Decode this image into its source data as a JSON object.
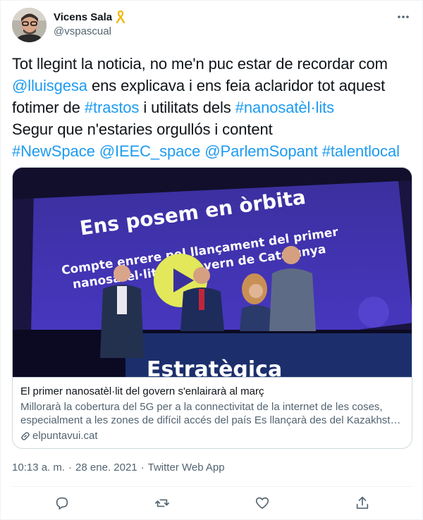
{
  "author": {
    "display_name": "Vicens Sala",
    "handle": "@vspascual",
    "ribbon_icon": "yellow-ribbon-icon",
    "ribbon_color": "#f5c518"
  },
  "tweet": {
    "line1": "Tot llegint la noticia, no me'n puc estar de recordar com",
    "line2_link": "@lluisgesa",
    "line2_text": " ens explicava i ens feia aclaridor tot aquest",
    "line3_text": "fotimer de ",
    "line3_link1": "#trastos",
    "line3_mid": " i utilitats dels ",
    "line3_link2": "#nanosatèl·lits",
    "line4": "Segur que n'estaries orgullós i content",
    "line5_links": [
      "#NewSpace",
      "@IEEC_space",
      "@ParlemSopant",
      "#talentlocal"
    ]
  },
  "card": {
    "image": {
      "headline": "Ens posem en òrbita",
      "subline1": "Compte enrere pel llançament del primer",
      "subline2": "nanosatèl·lit del Govern de Catalunya",
      "podium_word": "Estratègica"
    },
    "title": "El primer nanosatèl·lit del govern s'enlairarà al març",
    "description_line1": "Millorarà la cobertura del 5G per a la connectivitat de la internet de les coses,",
    "description_line2": "especialment a les zones de difícil accés del país Es llançarà des del Kazakhsta…",
    "domain": "elpuntavui.cat"
  },
  "meta": {
    "time": "10:13 a. m.",
    "date": "28 ene. 2021",
    "source": "Twitter Web App"
  },
  "colors": {
    "link": "#1d9bf0",
    "secondary_text": "#536471",
    "border": "#cfd9de"
  },
  "actions": [
    "reply-icon",
    "retweet-icon",
    "like-icon",
    "share-icon"
  ]
}
